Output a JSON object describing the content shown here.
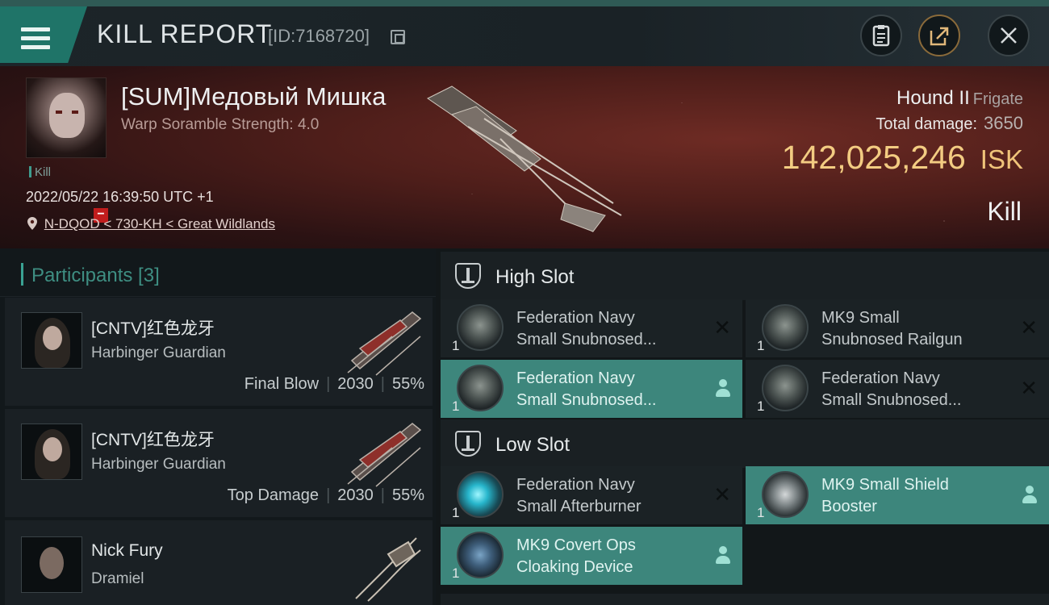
{
  "header": {
    "title": "KILL REPORT",
    "report_id": "[ID:7168720]"
  },
  "victim": {
    "name": "[SUM]Медовый Мишка",
    "subtitle": "Warp Soramble Strength: 4.0",
    "tag": "Kill",
    "datetime": "2022/05/22 16:39:50 UTC +1",
    "location": "N-DQOD < 730-KH < Great Wildlands",
    "ship_name": "Hound II",
    "ship_class": "Frigate",
    "total_damage_label": "Total damage:",
    "total_damage": "3650",
    "isk_value": "142,025,246",
    "isk_unit": "ISK",
    "result": "Kill"
  },
  "participants": {
    "header": "Participants [3]",
    "items": [
      {
        "name": "[CNTV]红色龙牙",
        "ship": "Harbinger Guardian",
        "role": "Final Blow",
        "damage": "2030",
        "percent": "55%"
      },
      {
        "name": "[CNTV]红色龙牙",
        "ship": "Harbinger Guardian",
        "role": "Top Damage",
        "damage": "2030",
        "percent": "55%"
      },
      {
        "name": "Nick Fury",
        "ship": "Dramiel",
        "role": "",
        "damage": "",
        "percent": ""
      }
    ]
  },
  "slots": {
    "high": {
      "label": "High Slot",
      "modules": [
        {
          "qty": "1",
          "name_line1": "Federation Navy",
          "name_line2": "Small Snubnosed...",
          "state": "destroyed"
        },
        {
          "qty": "1",
          "name_line1": "MK9 Small",
          "name_line2": "Snubnosed Railgun",
          "state": "destroyed"
        },
        {
          "qty": "1",
          "name_line1": "Federation Navy",
          "name_line2": "Small Snubnosed...",
          "state": "dropped"
        },
        {
          "qty": "1",
          "name_line1": "Federation Navy",
          "name_line2": "Small Snubnosed...",
          "state": "destroyed"
        }
      ]
    },
    "low": {
      "label": "Low Slot",
      "modules": [
        {
          "qty": "1",
          "name_line1": "Federation Navy",
          "name_line2": "Small Afterburner",
          "state": "destroyed"
        },
        {
          "qty": "1",
          "name_line1": "MK9 Small Shield",
          "name_line2": "Booster",
          "state": "dropped"
        },
        {
          "qty": "1",
          "name_line1": "MK9 Covert Ops",
          "name_line2": "Cloaking Device",
          "state": "dropped"
        }
      ]
    }
  },
  "colors": {
    "accent": "#3d867c",
    "isk": "#f3cc82",
    "panel": "#1a2024"
  },
  "icons": [
    "menu-icon",
    "copy-icon",
    "clipboard-icon",
    "share-icon",
    "close-icon",
    "pin-icon",
    "slot-icon",
    "person-icon",
    "x-icon"
  ]
}
